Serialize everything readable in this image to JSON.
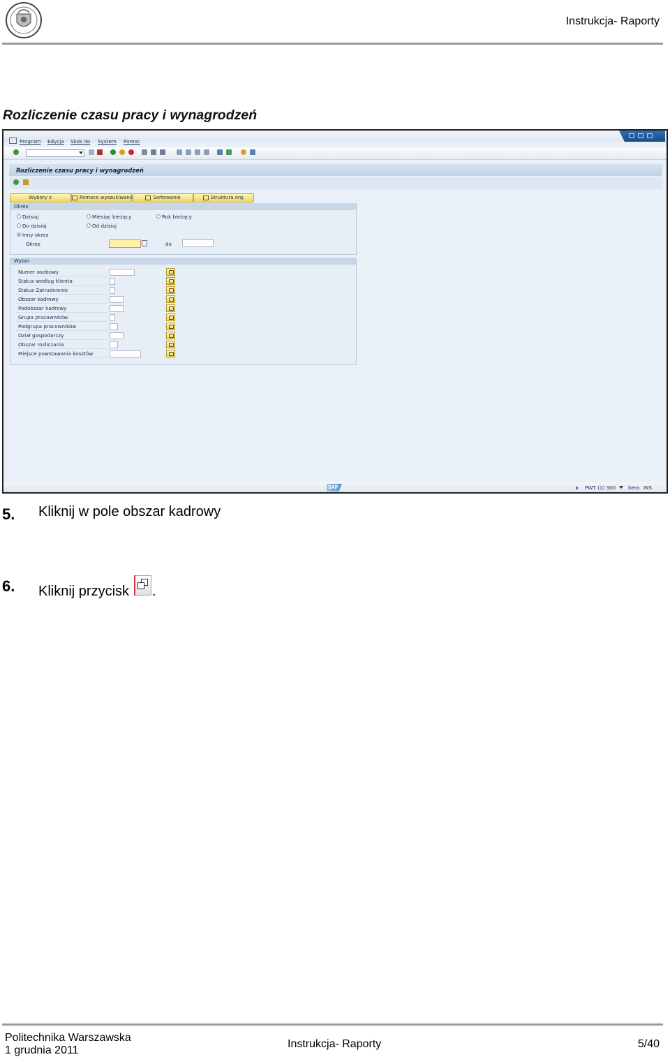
{
  "header": {
    "title": "Instrukcja- Raporty"
  },
  "section_heading": "Rozliczenie czasu pracy i wynagrodzeń",
  "sap": {
    "menu": [
      "Program",
      "Edycja",
      "Skok do",
      "System",
      "Pomoc"
    ],
    "screen_title": "Rozliczenie czasu pracy i wynagrodzeń",
    "buttons": [
      "Wybory z",
      "Pomoce wyszukiwania",
      "Sortowanie",
      "Struktura org."
    ],
    "okres": {
      "group_title": "Okres",
      "radios": [
        "Dzisiaj",
        "Do dzisiaj",
        "Inny okres",
        "Miesiąc bieżący",
        "Od dzisiaj",
        "Rok bieżący"
      ],
      "selected": "Inny okres",
      "field_label": "Okres",
      "to_label": "do"
    },
    "wybor": {
      "group_title": "Wybór",
      "rows": [
        "Numer osobowy",
        "Status według klienta",
        "Status Zatrudnienie",
        "Obszar kadrowy",
        "Podobszar kadrowy",
        "Grupa pracowników",
        "Podgrupa pracowników",
        "Dział gospodarczy",
        "Obszar rozliczania",
        "Miejsce powstawania kosztów"
      ]
    },
    "status": {
      "system": "PWT (1) 300",
      "server": "hera",
      "mode": "INS"
    }
  },
  "steps": [
    {
      "number": "5.",
      "text": "Kliknij w pole obszar kadrowy"
    },
    {
      "number": "6.",
      "text": "Kliknij przycisk",
      "suffix": ".",
      "icon": "multiple-selection-icon"
    }
  ],
  "footer": {
    "institution": "Politechnika Warszawska",
    "date": "1 grudnia 2011",
    "title": "Instrukcja- Raporty",
    "page": "5/40"
  }
}
